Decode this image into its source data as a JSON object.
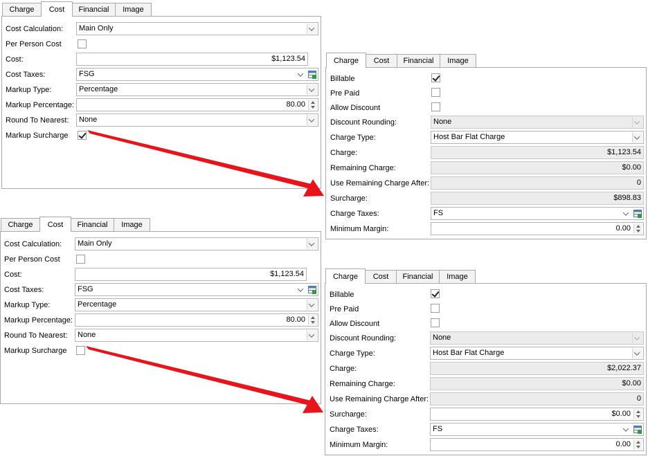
{
  "tabs": [
    "Charge",
    "Cost",
    "Financial",
    "Image"
  ],
  "cost_panel_checked": {
    "active_tab": "Cost",
    "labels": {
      "cost_calculation": "Cost Calculation:",
      "per_person_cost": "Per Person Cost",
      "cost": "Cost:",
      "cost_taxes": "Cost Taxes:",
      "markup_type": "Markup Type:",
      "markup_percentage": "Markup Percentage:",
      "round_to_nearest": "Round To Nearest:",
      "markup_surcharge": "Markup Surcharge"
    },
    "values": {
      "cost_calculation": "Main Only",
      "per_person_cost": false,
      "cost": "$1,123.54",
      "cost_taxes": "FSG",
      "markup_type": "Percentage",
      "markup_percentage": "80.00",
      "round_to_nearest": "None",
      "markup_surcharge": true
    }
  },
  "cost_panel_unchecked": {
    "active_tab": "Cost",
    "labels": {
      "cost_calculation": "Cost Calculation:",
      "per_person_cost": "Per Person Cost",
      "cost": "Cost:",
      "cost_taxes": "Cost Taxes:",
      "markup_type": "Markup Type:",
      "markup_percentage": "Markup Percentage:",
      "round_to_nearest": "Round To Nearest:",
      "markup_surcharge": "Markup Surcharge"
    },
    "values": {
      "cost_calculation": "Main Only",
      "per_person_cost": false,
      "cost": "$1,123.54",
      "cost_taxes": "FSG",
      "markup_type": "Percentage",
      "markup_percentage": "80.00",
      "round_to_nearest": "None",
      "markup_surcharge": false
    }
  },
  "charge_panel_checked": {
    "active_tab": "Charge",
    "labels": {
      "billable": "Billable",
      "pre_paid": "Pre Paid",
      "allow_discount": "Allow Discount",
      "discount_rounding": "Discount Rounding:",
      "charge_type": "Charge Type:",
      "charge": "Charge:",
      "remaining_charge": "Remaining Charge:",
      "use_remaining_charge_after": "Use Remaining Charge After:",
      "surcharge": "Surcharge:",
      "charge_taxes": "Charge Taxes:",
      "minimum_margin": "Minimum Margin:"
    },
    "values": {
      "billable": true,
      "pre_paid": false,
      "allow_discount": false,
      "discount_rounding": "None",
      "charge_type": "Host Bar Flat Charge",
      "charge": "$1,123.54",
      "remaining_charge": "$0.00",
      "use_remaining_charge_after": "0",
      "surcharge": "$898.83",
      "charge_taxes": "FS",
      "minimum_margin": "0.00"
    }
  },
  "charge_panel_unchecked": {
    "active_tab": "Charge",
    "labels": {
      "billable": "Billable",
      "pre_paid": "Pre Paid",
      "allow_discount": "Allow Discount",
      "discount_rounding": "Discount Rounding:",
      "charge_type": "Charge Type:",
      "charge": "Charge:",
      "remaining_charge": "Remaining Charge:",
      "use_remaining_charge_after": "Use Remaining Charge After:",
      "surcharge": "Surcharge:",
      "charge_taxes": "Charge Taxes:",
      "minimum_margin": "Minimum Margin:"
    },
    "values": {
      "billable": true,
      "pre_paid": false,
      "allow_discount": false,
      "discount_rounding": "None",
      "charge_type": "Host Bar Flat Charge",
      "charge": "$2,022.37",
      "remaining_charge": "$0.00",
      "use_remaining_charge_after": "0",
      "surcharge": "$0.00",
      "charge_taxes": "FS",
      "minimum_margin": "0.00"
    }
  },
  "colors": {
    "arrow": "#e8141a",
    "tab_border": "#a9a9a9",
    "readonly_bg": "#ececec"
  },
  "icons": {
    "lookup": "table-lookup-icon",
    "dropdown": "chevron-down-icon",
    "spin": "spin-updown-icon"
  }
}
